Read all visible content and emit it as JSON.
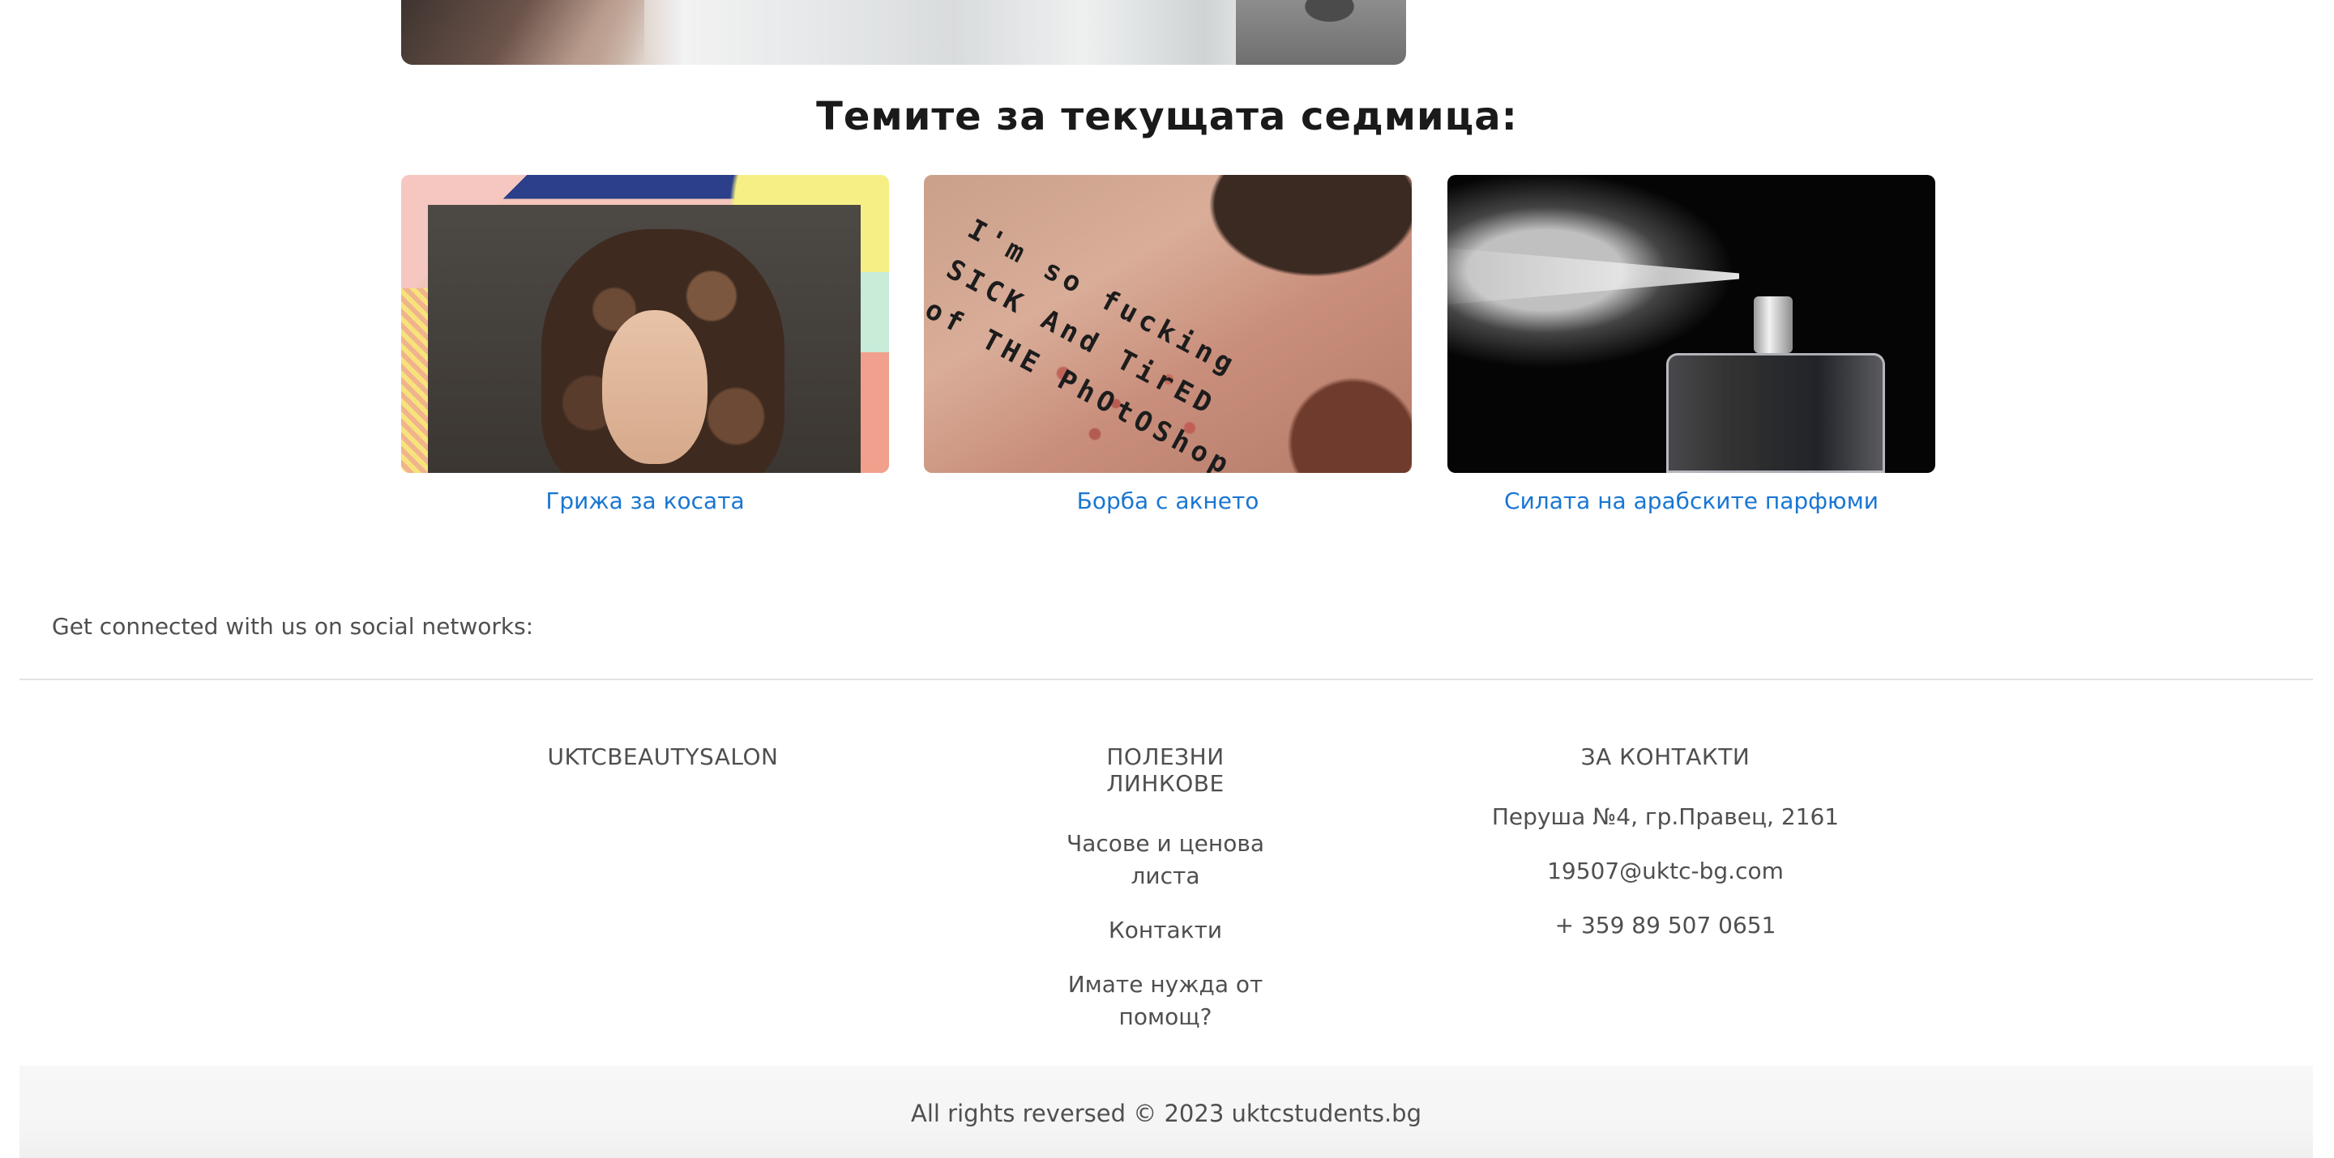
{
  "topics": {
    "heading": "Темите за текущата седмица:",
    "cards": [
      {
        "link": "Грижа за косата",
        "image_icon": "curly-hair-photo"
      },
      {
        "link": "Борба с акнето",
        "image_icon": "acne-skin-photo",
        "image_text": [
          "I'm so fucking",
          "SICK And TirED",
          "of THE PhOtOShop"
        ]
      },
      {
        "link": "Силата на арабските парфюми",
        "image_icon": "perfume-spray-photo"
      }
    ]
  },
  "footer": {
    "social_text": "Get connected with us on social networks:",
    "brand": {
      "title": "UKTCBEAUTYSALON"
    },
    "links": {
      "title": "ПОЛЕЗНИ ЛИНКОВЕ",
      "items": [
        "Часове и ценова листа",
        "Контакти",
        "Имате нужда от помощ?"
      ]
    },
    "contacts": {
      "title": "ЗА КОНТАКТИ",
      "address": "Перуша №4, гр.Правец, 2161",
      "email": "19507@uktc-bg.com",
      "phone": "+ 359 89 507 0651"
    },
    "copyright_prefix": "All rights reversed © 2023 ",
    "copyright_link": "uktcstudents.bg"
  },
  "colors": {
    "link": "#1976d2",
    "text": "#4f4f4f",
    "heading": "#1a1a1a"
  }
}
